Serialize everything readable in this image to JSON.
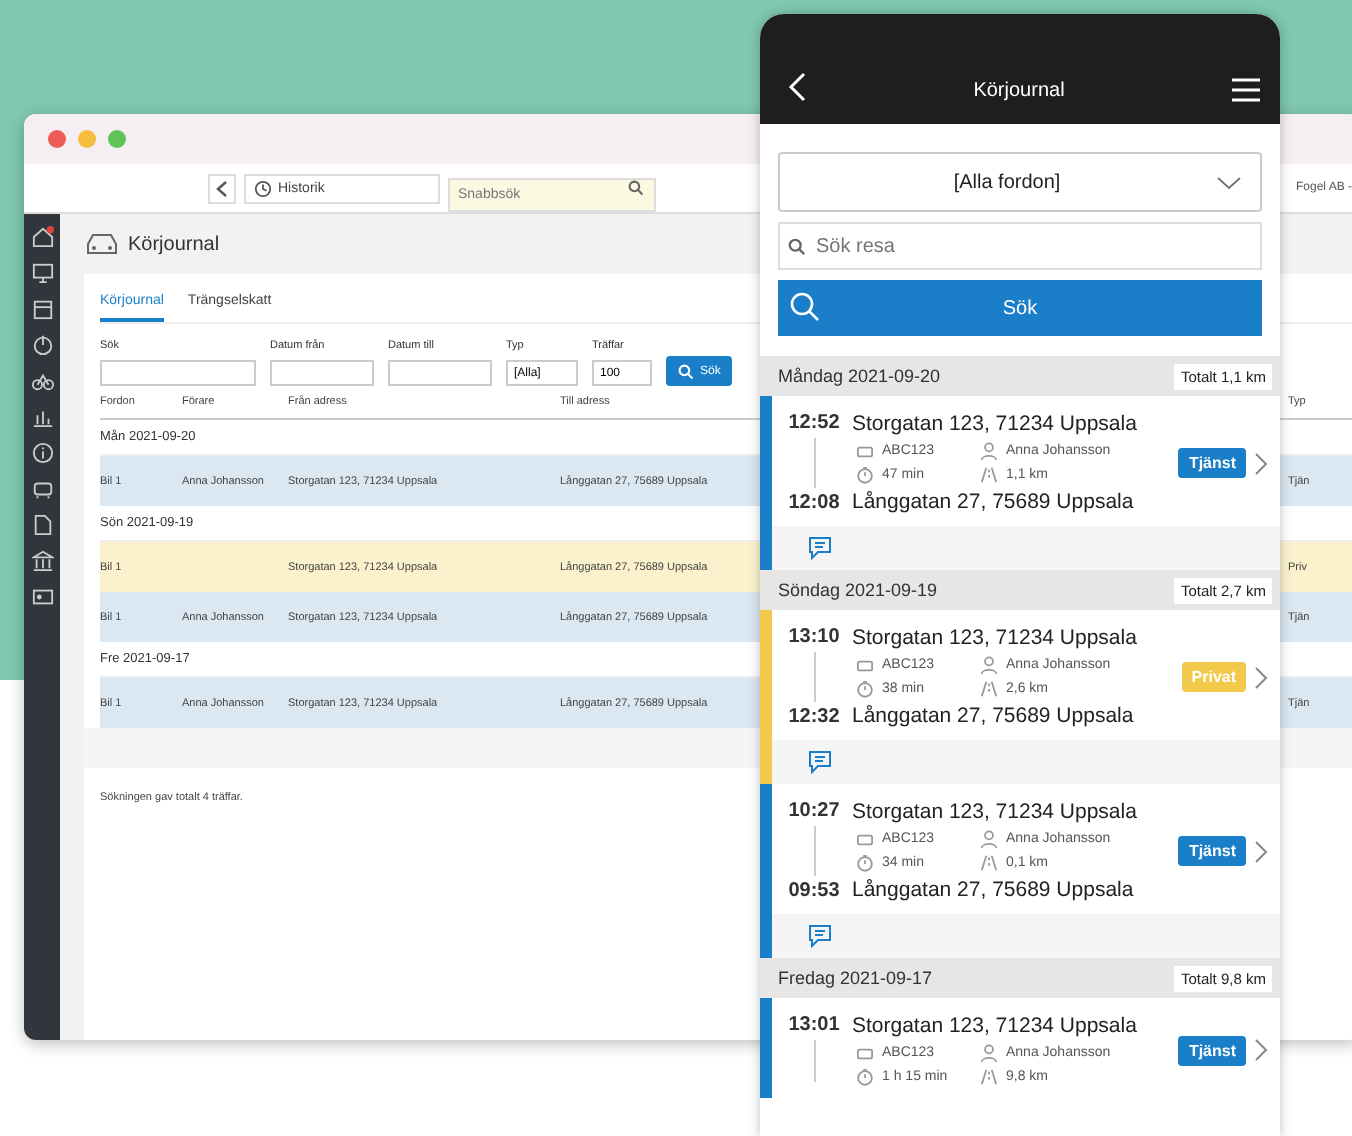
{
  "desktop": {
    "toolbar": {
      "history_label": "Historik",
      "quick_search_placeholder": "Snabbsök",
      "company": "Fogel AB -"
    },
    "title": "Körjournal",
    "tabs": [
      {
        "label": "Körjournal",
        "selected": true
      },
      {
        "label": "Trängselskatt",
        "selected": false
      }
    ],
    "filters": {
      "search_label": "Sök",
      "date_from_label": "Datum från",
      "date_to_label": "Datum till",
      "type_label": "Typ",
      "type_value": "[Alla]",
      "hits_label": "Träffar",
      "hits_value": "100",
      "search_button": "Sök"
    },
    "table": {
      "columns": [
        "Fordon",
        "Förare",
        "Från adress",
        "Till adress"
      ],
      "type_column": "Typ",
      "groups": [
        {
          "label": "Mån 2021-09-20",
          "rows": [
            {
              "kind": "business",
              "cells": [
                "Bil 1",
                "Anna Johansson",
                "Storgatan 123, 71234 Uppsala",
                "Långgatan 27, 75689 Uppsala"
              ],
              "type": "Tjän"
            }
          ]
        },
        {
          "label": "Sön 2021-09-19",
          "rows": [
            {
              "kind": "private",
              "cells": [
                "Bil 1",
                "",
                "Storgatan 123, 71234 Uppsala",
                "Långgatan 27, 75689 Uppsala"
              ],
              "type": "Priv"
            },
            {
              "kind": "business",
              "cells": [
                "Bil 1",
                "Anna Johansson",
                "Storgatan 123, 71234 Uppsala",
                "Långgatan 27, 75689 Uppsala"
              ],
              "type": "Tjän"
            }
          ]
        },
        {
          "label": "Fre 2021-09-17",
          "rows": [
            {
              "kind": "business",
              "cells": [
                "Bil 1",
                "Anna Johansson",
                "Storgatan 123, 71234 Uppsala",
                "Långgatan 27, 75689 Uppsala"
              ],
              "type": "Tjän"
            }
          ]
        }
      ]
    },
    "footer": "Sökningen gav totalt 4 träffar."
  },
  "phone": {
    "title": "Körjournal",
    "vehicle_select": "[Alla fordon]",
    "search_placeholder": "Sök resa",
    "search_button": "Sök",
    "days": [
      {
        "label": "Måndag 2021-09-20",
        "total": "Totalt 1,1 km",
        "trips": [
          {
            "kind": "business",
            "start": "12:52",
            "from": "Storgatan 123, 71234 Uppsala",
            "end": "12:08",
            "to": "Långgatan 27, 75689 Uppsala",
            "vehicle": "ABC123",
            "driver": "Anna Johansson",
            "duration": "47 min",
            "distance": "1,1 km",
            "badge": "Tjänst",
            "comment": true
          }
        ]
      },
      {
        "label": "Söndag 2021-09-19",
        "total": "Totalt 2,7 km",
        "trips": [
          {
            "kind": "private",
            "start": "13:10",
            "from": "Storgatan 123, 71234 Uppsala",
            "end": "12:32",
            "to": "Långgatan 27, 75689 Uppsala",
            "vehicle": "ABC123",
            "driver": "Anna Johansson",
            "duration": "38 min",
            "distance": "2,6 km",
            "badge": "Privat",
            "comment": true
          },
          {
            "kind": "business",
            "start": "10:27",
            "from": "Storgatan 123, 71234 Uppsala",
            "end": "09:53",
            "to": "Långgatan 27, 75689 Uppsala",
            "vehicle": "ABC123",
            "driver": "Anna Johansson",
            "duration": "34 min",
            "distance": "0,1 km",
            "badge": "Tjänst",
            "comment": true
          }
        ]
      },
      {
        "label": "Fredag 2021-09-17",
        "total": "Totalt 9,8 km",
        "trips": [
          {
            "kind": "business",
            "start": "13:01",
            "from": "Storgatan 123, 71234 Uppsala",
            "vehicle": "ABC123",
            "driver": "Anna Johansson",
            "duration": "1 h 15 min",
            "distance": "9,8 km",
            "badge": "Tjänst",
            "comment": false
          }
        ]
      }
    ]
  }
}
